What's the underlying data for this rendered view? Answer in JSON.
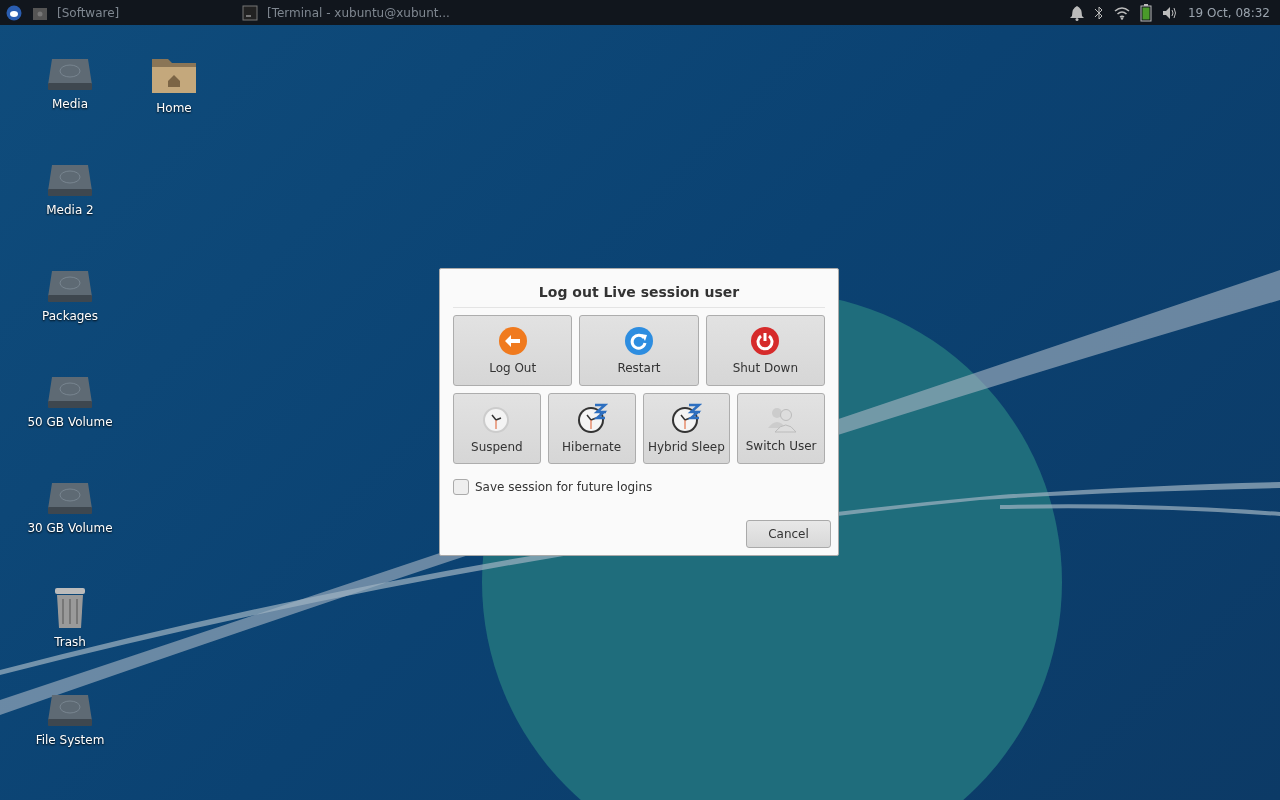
{
  "panel": {
    "tasks": [
      {
        "kind": "software",
        "label": "[Software]"
      },
      {
        "kind": "terminal",
        "label": "[Terminal - xubuntu@xubunt..."
      }
    ],
    "clock": "19 Oct, 08:32"
  },
  "desktop_icons": [
    {
      "kind": "drive",
      "label": "Media"
    },
    {
      "kind": "drive",
      "label": "Media 2"
    },
    {
      "kind": "drive",
      "label": "Packages"
    },
    {
      "kind": "drive",
      "label": "50 GB Volume"
    },
    {
      "kind": "drive",
      "label": "30 GB Volume"
    },
    {
      "kind": "trash",
      "label": "Trash"
    },
    {
      "kind": "drive",
      "label": "File System"
    },
    {
      "kind": "folder",
      "label": "Home"
    }
  ],
  "dialog": {
    "title": "Log out Live session user",
    "actions_row_1": [
      {
        "kind": "logout",
        "label": "Log Out"
      },
      {
        "kind": "restart",
        "label": "Restart"
      },
      {
        "kind": "shutdown",
        "label": "Shut Down"
      }
    ],
    "actions_row_2": [
      {
        "kind": "suspend",
        "label": "Suspend"
      },
      {
        "kind": "hibernate",
        "label": "Hibernate"
      },
      {
        "kind": "hybrid",
        "label": "Hybrid Sleep"
      },
      {
        "kind": "switch",
        "label": "Switch User"
      }
    ],
    "save_session": {
      "label": "Save session for future logins",
      "checked": false
    },
    "cancel": "Cancel"
  }
}
